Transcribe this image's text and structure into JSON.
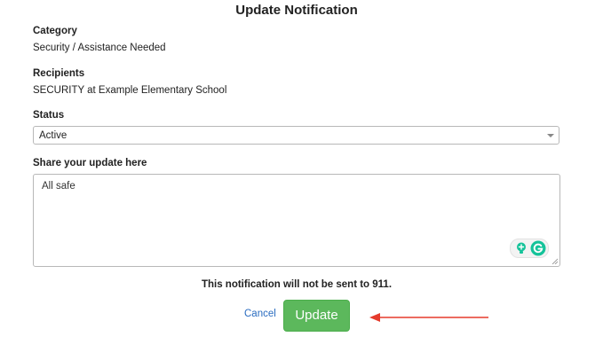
{
  "dialog": {
    "title": "Update Notification"
  },
  "category": {
    "label": "Category",
    "value": "Security / Assistance Needed"
  },
  "recipients": {
    "label": "Recipients",
    "value": "SECURITY at Example Elementary School"
  },
  "status": {
    "label": "Status",
    "selected": "Active"
  },
  "update_text": {
    "label": "Share your update here",
    "value": "All safe"
  },
  "notice": "This notification will not be sent to 911.",
  "actions": {
    "cancel_label": "Cancel",
    "update_label": "Update"
  },
  "colors": {
    "update_button": "#5cb85c",
    "cancel_link": "#2a6cc0",
    "annotation_arrow": "#e53b2c",
    "grammarly": "#15c39a"
  },
  "icons": {
    "status_caret": "chevron-down-icon",
    "grammarly_bulb": "lightbulb-icon",
    "grammarly": "grammarly-icon",
    "annotation": "arrow-left-icon"
  }
}
